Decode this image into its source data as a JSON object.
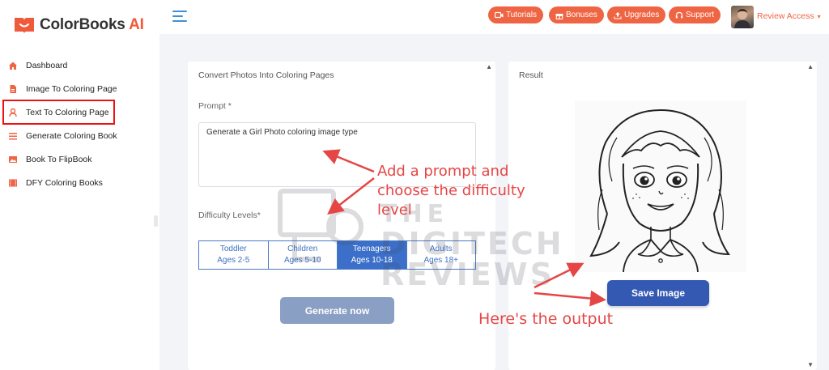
{
  "brand": {
    "name": "ColorBooks",
    "suffix": "AI",
    "accent": "#f05a3c"
  },
  "sidebar": {
    "items": [
      {
        "label": "Dashboard",
        "icon": "home-icon"
      },
      {
        "label": "Image To Coloring Page",
        "icon": "file-icon"
      },
      {
        "label": "Text To Coloring Page",
        "icon": "user-icon",
        "active": true
      },
      {
        "label": "Generate Coloring Book",
        "icon": "list-icon"
      },
      {
        "label": "Book To FlipBook",
        "icon": "image-icon"
      },
      {
        "label": "DFY Coloring Books",
        "icon": "film-icon"
      }
    ]
  },
  "topbar": {
    "buttons": [
      {
        "label": "Tutorials",
        "icon": "video-icon"
      },
      {
        "label": "Bonuses",
        "icon": "gift-icon"
      },
      {
        "label": "Upgrades",
        "icon": "upload-icon"
      },
      {
        "label": "Support",
        "icon": "headset-icon"
      }
    ],
    "user_label": "Review Access",
    "accent": "#ef6443"
  },
  "left_card": {
    "title": "Convert Photos Into Coloring Pages",
    "prompt_label": "Prompt *",
    "prompt_value": "Generate a Girl Photo coloring image type",
    "difficulty_label": "Difficulty Levels*",
    "levels": [
      {
        "name": "Toddler",
        "ages": "Ages 2-5"
      },
      {
        "name": "Children",
        "ages": "Ages 5-10"
      },
      {
        "name": "Teenagers",
        "ages": "Ages 10-18",
        "selected": true
      },
      {
        "name": "Adults",
        "ages": "Ages 18+"
      }
    ],
    "generate_label": "Generate now"
  },
  "right_card": {
    "title": "Result",
    "save_label": "Save Image"
  },
  "annotations": {
    "prompt_note": "Add a prompt and choose the difficulty level",
    "output_note": "Here's the output",
    "color": "#e64545"
  },
  "watermark": {
    "line1": "THE",
    "line2": "DIGITECH",
    "line3": "REVIEWS"
  }
}
